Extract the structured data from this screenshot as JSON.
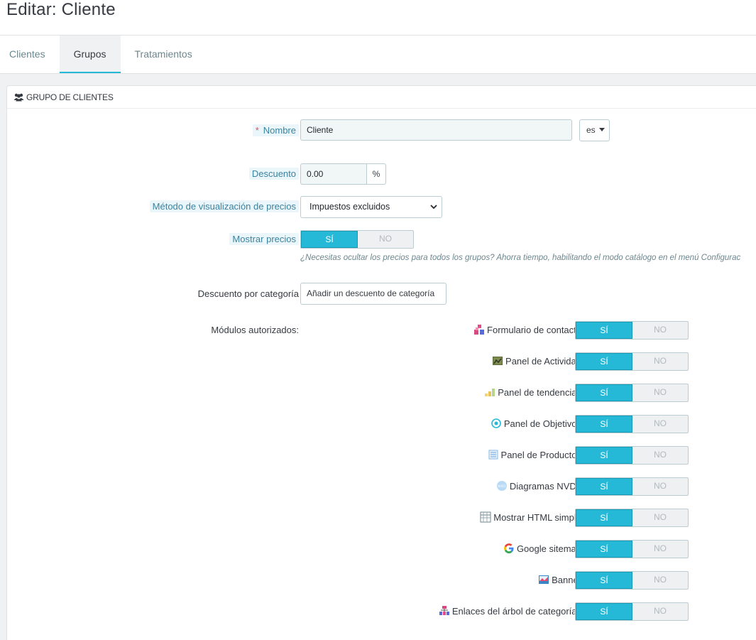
{
  "header": {
    "title": "Editar: Cliente",
    "tabs": [
      {
        "label": "Clientes"
      },
      {
        "label": "Grupos"
      },
      {
        "label": "Tratamientos"
      }
    ]
  },
  "panel": {
    "title": "GRUPO DE CLIENTES",
    "name": {
      "label": "Nombre",
      "required_mark": "*",
      "value": "Cliente",
      "lang": "es"
    },
    "discount": {
      "label": "Descuento",
      "value": "0.00",
      "unit": "%"
    },
    "price_display": {
      "label": "Método de visualización de precios",
      "selected": "Impuestos excluidos"
    },
    "show_prices": {
      "label": "Mostrar precios",
      "yes": "SÍ",
      "no": "NO",
      "help": "¿Necesitas ocultar los precios para todos los grupos? Ahorra tiempo, habilitando el modo catálogo en el menú Configurac"
    },
    "category_discount": {
      "label": "Descuento por categoría",
      "button": "Añadir un descuento de categoría"
    },
    "modules": {
      "label": "Módulos autorizados:",
      "yes": "SÍ",
      "no": "NO",
      "items": [
        {
          "name": "Formulario de contacto",
          "icon": "contact-form-icon"
        },
        {
          "name": "Panel de Actividad",
          "icon": "activity-panel-icon"
        },
        {
          "name": "Panel de tendencias",
          "icon": "trends-panel-icon"
        },
        {
          "name": "Panel de Objetivos",
          "icon": "goals-panel-icon"
        },
        {
          "name": "Panel de Productos",
          "icon": "products-panel-icon"
        },
        {
          "name": "Diagramas NVD3",
          "icon": "nvd3-charts-icon"
        },
        {
          "name": "Mostrar HTML simple",
          "icon": "simple-html-icon"
        },
        {
          "name": "Google sitemap",
          "icon": "google-icon"
        },
        {
          "name": "Banner",
          "icon": "banner-icon"
        },
        {
          "name": "Enlaces del árbol de categorías",
          "icon": "category-tree-icon"
        }
      ]
    }
  },
  "colors": {
    "accent": "#25b9d7",
    "hint_bg": "#eaf6f9",
    "hint_text": "#3c83a0",
    "required": "#c05c67"
  }
}
